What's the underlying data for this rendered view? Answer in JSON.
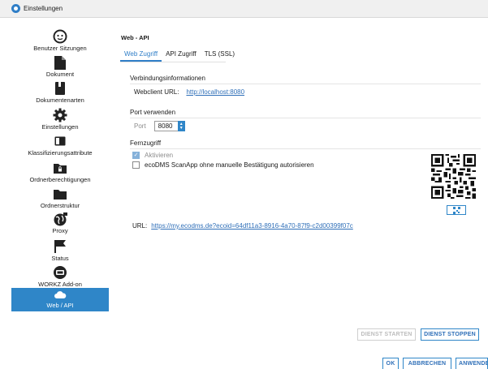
{
  "window": {
    "title": "Einstellungen"
  },
  "sidebar": {
    "items": [
      {
        "label": "Benutzer Sitzungen",
        "icon": "user-sessions-icon"
      },
      {
        "label": "Dokument",
        "icon": "document-icon"
      },
      {
        "label": "Dokumentenarten",
        "icon": "document-types-icon"
      },
      {
        "label": "Einstellungen",
        "icon": "gear-icon"
      },
      {
        "label": "Klassifizierungsattribute",
        "icon": "classification-icon"
      },
      {
        "label": "Ordnerberechtigungen",
        "icon": "folder-lock-icon"
      },
      {
        "label": "Ordnerstruktur",
        "icon": "folder-icon"
      },
      {
        "label": "Proxy",
        "icon": "globe-icon"
      },
      {
        "label": "Status",
        "icon": "flag-icon"
      },
      {
        "label": "WORKZ Add-on",
        "icon": "workz-icon"
      },
      {
        "label": "Web / API",
        "icon": "cloud-icon"
      }
    ],
    "active_index": 10
  },
  "main": {
    "section_title": "Web - API",
    "tabs": [
      "Web Zugriff",
      "API Zugriff",
      "TLS (SSL)"
    ],
    "active_tab": 0,
    "connection": {
      "heading": "Verbindungsinformationen",
      "label": "Webclient URL:",
      "url": "http://localhost:8080"
    },
    "port": {
      "heading": "Port verwenden",
      "label": "Port",
      "value": "8080"
    },
    "remote": {
      "heading": "Fernzugriff",
      "activate_label": "Aktivieren",
      "activate_checked": true,
      "scanapp_label": "ecoDMS ScanApp ohne manuelle Bestätigung autorisieren",
      "scanapp_checked": false,
      "url_label": "URL:",
      "url": "https://my.ecodms.de?ecoid=64df11a3-8916-4a70-87f9-c2d00399f07c"
    }
  },
  "buttons": {
    "start": "DIENST STARTEN",
    "stop": "DIENST STOPPEN",
    "ok": "OK",
    "cancel": "ABBRECHEN",
    "apply": "ANWENDEN"
  },
  "colors": {
    "accent": "#2f86c8",
    "link": "#2f6fb8"
  }
}
